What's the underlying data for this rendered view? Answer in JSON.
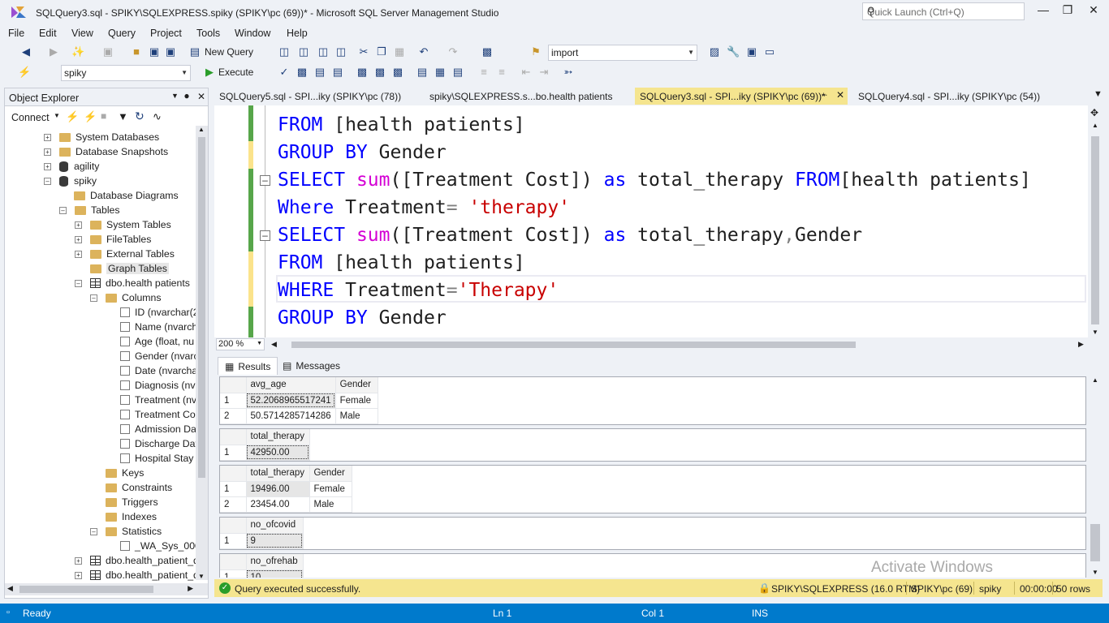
{
  "window": {
    "title": "SQLQuery3.sql - SPIKY\\SQLEXPRESS.spiky (SPIKY\\pc (69))* - Microsoft SQL Server Management Studio",
    "quick_launch_placeholder": "Quick Launch (Ctrl+Q)"
  },
  "menu": [
    "File",
    "Edit",
    "View",
    "Query",
    "Project",
    "Tools",
    "Window",
    "Help"
  ],
  "toolbar": {
    "new_query": "New Query",
    "search_combo": "import",
    "database_combo": "spiky",
    "execute": "Execute"
  },
  "object_explorer": {
    "title": "Object Explorer",
    "connect": "Connect",
    "tree": [
      "System Databases",
      "Database Snapshots",
      "agility",
      "spiky",
      "Database Diagrams",
      "Tables",
      "System Tables",
      "FileTables",
      "External Tables",
      "Graph Tables",
      "dbo.health patients",
      "Columns",
      "ID (nvarchar(2",
      "Name (nvarch",
      "Age (float, nu",
      "Gender (nvarc",
      "Date (nvarcha",
      "Diagnosis (nva",
      "Treatment (nv",
      "Treatment Co",
      "Admission Da",
      "Discharge Dat",
      "Hospital Stay",
      "Keys",
      "Constraints",
      "Triggers",
      "Indexes",
      "Statistics",
      "_WA_Sys_0000",
      "dbo.health_patient_d",
      "dbo.health_patient_d"
    ]
  },
  "tabs": [
    "SQLQuery5.sql - SPI...iky (SPIKY\\pc (78))",
    "spiky\\SQLEXPRESS.s...bo.health patients",
    "SQLQuery3.sql - SPI...iky (SPIKY\\pc (69))*",
    "SQLQuery4.sql - SPI...iky (SPIKY\\pc (54))"
  ],
  "editor": {
    "zoom": "200 %",
    "lines": [
      {
        "kw1": "FROM",
        "rest": " [health patients]"
      },
      {
        "kw1": "GROUP BY",
        "rest": " Gender"
      },
      {
        "kw1": "SELECT",
        "fn": "sum",
        "a": "([Treatment Cost])",
        "kw2": " as",
        "b": " total_therapy ",
        "kw3": "FROM",
        "c": "[health patients]"
      },
      {
        "kw1": "Where",
        "a": " Treatment",
        "op": "=",
        "str": " 'therapy'"
      },
      {
        "kw1": "SELECT",
        "fn": "sum",
        "a": "([Treatment Cost])",
        "kw2": " as",
        "b": " total_therapy",
        "op": ",",
        "c": "Gender"
      },
      {
        "kw1": "FROM",
        "rest": " [health patients]"
      },
      {
        "kw1": "WHERE",
        "a": " Treatment",
        "op": "=",
        "str": "'Therapy'"
      },
      {
        "kw1": "GROUP BY",
        "rest": " Gender"
      }
    ]
  },
  "results_tabs": {
    "results": "Results",
    "messages": "Messages"
  },
  "results": [
    {
      "headers": [
        "avg_age",
        "Gender"
      ],
      "rows": [
        [
          "1",
          "52.2068965517241",
          "Female"
        ],
        [
          "2",
          "50.5714285714286",
          "Male"
        ]
      ]
    },
    {
      "headers": [
        "total_therapy"
      ],
      "rows": [
        [
          "1",
          "42950.00"
        ]
      ]
    },
    {
      "headers": [
        "total_therapy",
        "Gender"
      ],
      "rows": [
        [
          "1",
          "19496.00",
          "Female"
        ],
        [
          "2",
          "23454.00",
          "Male"
        ]
      ]
    },
    {
      "headers": [
        "no_ofcovid"
      ],
      "rows": [
        [
          "1",
          "9"
        ]
      ]
    },
    {
      "headers": [
        "no_ofrehab"
      ],
      "rows": [
        [
          "1",
          "10"
        ]
      ]
    }
  ],
  "query_status": {
    "message": "Query executed successfully.",
    "server": "SPIKY\\SQLEXPRESS (16.0 RTM)",
    "user": "SPIKY\\pc (69)",
    "database": "spiky",
    "time": "00:00:00",
    "rows": "50 rows"
  },
  "statusbar": {
    "ready": "Ready",
    "ln": "Ln 1",
    "col": "Col 1",
    "ins": "INS"
  },
  "watermark": "Activate Windows"
}
